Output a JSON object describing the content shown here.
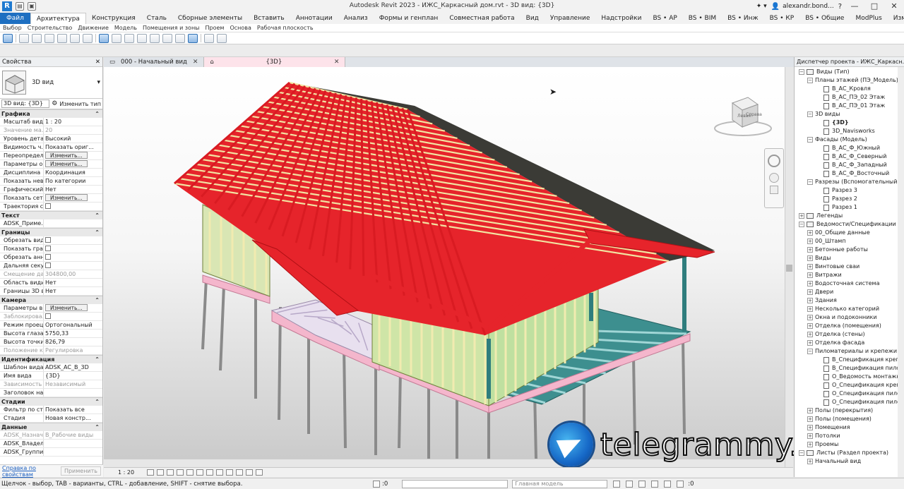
{
  "titlebar": {
    "app_logo": "R",
    "title": "Autodesk Revit 2023 - ИЖС_Каркасный дом.rvt - 3D вид: {3D}",
    "user": "alexandr.bond...",
    "min": "—",
    "max": "□",
    "close": "✕"
  },
  "ribbon_tabs": [
    "Файл",
    "Архитектура",
    "Конструкция",
    "Сталь",
    "Сборные элементы",
    "Вставить",
    "Аннотации",
    "Анализ",
    "Формы и генплан",
    "Совместная работа",
    "Вид",
    "Управление",
    "Надстройки",
    "BS • AP",
    "BS • BIM",
    "BS • Инж",
    "BS • КР",
    "BS • Общие",
    "ModPlus",
    "Изменить"
  ],
  "ribbon_panels": [
    "Выбор",
    "Строительство",
    "Движение",
    "Модель",
    "Помещения и зоны",
    "Проем",
    "Основа",
    "Рабочая плоскость"
  ],
  "properties": {
    "title": "Свойства",
    "close": "✕",
    "type_name": "3D вид",
    "filter": "3D вид: {3D}",
    "edit_type": "Изменить тип",
    "footer_link": "Справка по свойствам",
    "apply": "Применить",
    "groups": [
      {
        "name": "Графика",
        "rows": [
          {
            "n": "Масштаб вида",
            "v": "1 : 20"
          },
          {
            "n": "Значение ма...",
            "v": "20",
            "dim": true
          },
          {
            "n": "Уровень дета...",
            "v": "Высокий"
          },
          {
            "n": "Видимость ч...",
            "v": "Показать ориг..."
          },
          {
            "n": "Переопредел...",
            "btn": "Изменить..."
          },
          {
            "n": "Параметры о...",
            "btn": "Изменить..."
          },
          {
            "n": "Дисциплина",
            "v": "Координация"
          },
          {
            "n": "Показать нев...",
            "v": "По категории"
          },
          {
            "n": "Графический...",
            "v": "Нет"
          },
          {
            "n": "Показать сетки",
            "btn": "Изменить..."
          },
          {
            "n": "Траектория с...",
            "chk": true
          }
        ]
      },
      {
        "name": "Текст",
        "rows": [
          {
            "n": "ADSK_Приме...",
            "v": ""
          }
        ]
      },
      {
        "name": "Границы",
        "rows": [
          {
            "n": "Обрезать вид",
            "chk": true
          },
          {
            "n": "Показать гра...",
            "chk": true
          },
          {
            "n": "Обрезать анн...",
            "chk": true
          },
          {
            "n": "Дальняя секу...",
            "chk": true
          },
          {
            "n": "Смещение да...",
            "v": "304800,00",
            "dim": true
          },
          {
            "n": "Область види...",
            "v": "Нет"
          },
          {
            "n": "Границы 3D в...",
            "v": "Нет"
          }
        ]
      },
      {
        "name": "Камера",
        "rows": [
          {
            "n": "Параметры в...",
            "btn": "Изменить..."
          },
          {
            "n": "Заблокирова...",
            "chk": true,
            "dim": true
          },
          {
            "n": "Режим проец...",
            "v": "Ортогональный"
          },
          {
            "n": "Высота глаза",
            "v": "5750,33"
          },
          {
            "n": "Высота точки...",
            "v": "826,79"
          },
          {
            "n": "Положение к...",
            "v": "Регулировка",
            "dim": true
          }
        ]
      },
      {
        "name": "Идентификация",
        "rows": [
          {
            "n": "Шаблон вида",
            "v": "ADSK_АС_В_3D"
          },
          {
            "n": "Имя вида",
            "v": "{3D}"
          },
          {
            "n": "Зависимость ...",
            "v": "Независимый",
            "dim": true
          },
          {
            "n": "Заголовок на...",
            "v": ""
          }
        ]
      },
      {
        "name": "Стадии",
        "rows": [
          {
            "n": "Фильтр по ст...",
            "v": "Показать все"
          },
          {
            "n": "Стадия",
            "v": "Новая констр..."
          }
        ]
      },
      {
        "name": "Данные",
        "rows": [
          {
            "n": "ADSK_Назнач...",
            "v": "В_Рабочие виды",
            "dim": true
          },
          {
            "n": "ADSK_Владел...",
            "v": ""
          },
          {
            "n": "ADSK_Группи...",
            "v": ""
          }
        ]
      }
    ]
  },
  "view_tabs": [
    {
      "label": "000 - Начальный вид",
      "active": false
    },
    {
      "label": "{3D}",
      "active": true
    }
  ],
  "viewcube": {
    "left": "Левая",
    "right": "Справа"
  },
  "watermark": "telegrammy.net",
  "view_control": {
    "scale": "1 : 20"
  },
  "browser": {
    "title": "Диспетчер проекта - ИЖС_Каркасн...",
    "close": "✕",
    "nodes": [
      {
        "label": "Виды (Тип)",
        "level": 0,
        "exp": "−",
        "kind": "fold",
        "bold": false
      },
      {
        "label": "Планы этажей (ПЭ_Модель)",
        "level": 1,
        "exp": "−",
        "kind": ""
      },
      {
        "label": "В_АС_Кровля",
        "level": 2,
        "kind": "leaf"
      },
      {
        "label": "В_АС_ПЭ_02 Этаж",
        "level": 2,
        "kind": "leaf"
      },
      {
        "label": "В_АС_ПЭ_01 Этаж",
        "level": 2,
        "kind": "leaf"
      },
      {
        "label": "3D виды",
        "level": 1,
        "exp": "−",
        "kind": ""
      },
      {
        "label": "{3D}",
        "level": 2,
        "kind": "leaf",
        "bold": true
      },
      {
        "label": "3D_Navisworks",
        "level": 2,
        "kind": "leaf"
      },
      {
        "label": "Фасады (Модель)",
        "level": 1,
        "exp": "−",
        "kind": ""
      },
      {
        "label": "В_АС_Ф_Южный",
        "level": 2,
        "kind": "leaf"
      },
      {
        "label": "В_АС_Ф_Северный",
        "level": 2,
        "kind": "leaf"
      },
      {
        "label": "В_АС_Ф_Западный",
        "level": 2,
        "kind": "leaf"
      },
      {
        "label": "В_АС_Ф_Восточный",
        "level": 2,
        "kind": "leaf"
      },
      {
        "label": "Разрезы (Вспомогательный)",
        "level": 1,
        "exp": "−",
        "kind": ""
      },
      {
        "label": "Разрез 3",
        "level": 2,
        "kind": "leaf"
      },
      {
        "label": "Разрез 2",
        "level": 2,
        "kind": "leaf"
      },
      {
        "label": "Разрез 1",
        "level": 2,
        "kind": "leaf"
      },
      {
        "label": "Легенды",
        "level": 0,
        "exp": "+",
        "kind": "fold"
      },
      {
        "label": "Ведомости/Спецификации (Наз",
        "level": 0,
        "exp": "−",
        "kind": "fold"
      },
      {
        "label": "00_Общие данные",
        "level": 1,
        "exp": "+",
        "kind": ""
      },
      {
        "label": "00_Штамп",
        "level": 1,
        "exp": "+",
        "kind": ""
      },
      {
        "label": "Бетонные работы",
        "level": 1,
        "exp": "+",
        "kind": ""
      },
      {
        "label": "Виды",
        "level": 1,
        "exp": "+",
        "kind": ""
      },
      {
        "label": "Винтовые сваи",
        "level": 1,
        "exp": "+",
        "kind": ""
      },
      {
        "label": "Витражи",
        "level": 1,
        "exp": "+",
        "kind": ""
      },
      {
        "label": "Водосточная система",
        "level": 1,
        "exp": "+",
        "kind": ""
      },
      {
        "label": "Двери",
        "level": 1,
        "exp": "+",
        "kind": ""
      },
      {
        "label": "Здания",
        "level": 1,
        "exp": "+",
        "kind": ""
      },
      {
        "label": "Несколько категорий",
        "level": 1,
        "exp": "+",
        "kind": ""
      },
      {
        "label": "Окна и подоконники",
        "level": 1,
        "exp": "+",
        "kind": ""
      },
      {
        "label": "Отделка (помещения)",
        "level": 1,
        "exp": "+",
        "kind": ""
      },
      {
        "label": "Отделка (стены)",
        "level": 1,
        "exp": "+",
        "kind": ""
      },
      {
        "label": "Отделка фасада",
        "level": 1,
        "exp": "+",
        "kind": ""
      },
      {
        "label": "Пиломатериалы и крепежи",
        "level": 1,
        "exp": "−",
        "kind": ""
      },
      {
        "label": "В_Спецификация крепеж",
        "level": 2,
        "kind": "leaf"
      },
      {
        "label": "В_Спецификация пилом",
        "level": 2,
        "kind": "leaf"
      },
      {
        "label": "О_Ведомость монтажны",
        "level": 2,
        "kind": "leaf"
      },
      {
        "label": "О_Спецификация крепе",
        "level": 2,
        "kind": "leaf"
      },
      {
        "label": "О_Спецификация пилом",
        "level": 2,
        "kind": "leaf"
      },
      {
        "label": "О_Спецификация пилом",
        "level": 2,
        "kind": "leaf"
      },
      {
        "label": "Полы (перекрытия)",
        "level": 1,
        "exp": "+",
        "kind": ""
      },
      {
        "label": "Полы (помещения)",
        "level": 1,
        "exp": "+",
        "kind": ""
      },
      {
        "label": "Помещения",
        "level": 1,
        "exp": "+",
        "kind": ""
      },
      {
        "label": "Потолки",
        "level": 1,
        "exp": "+",
        "kind": ""
      },
      {
        "label": "Проемы",
        "level": 1,
        "exp": "+",
        "kind": ""
      },
      {
        "label": "Листы (Раздел проекта)",
        "level": 0,
        "exp": "−",
        "kind": "fold"
      },
      {
        "label": "Начальный вид",
        "level": 1,
        "exp": "+",
        "kind": ""
      }
    ]
  },
  "status": {
    "hint": "Щелчок - выбор, TAB - варианты, CTRL - добавление, SHIFT - снятие выбора.",
    "zero1": ":0",
    "model": "Главная модель",
    "zero2": ":0"
  }
}
